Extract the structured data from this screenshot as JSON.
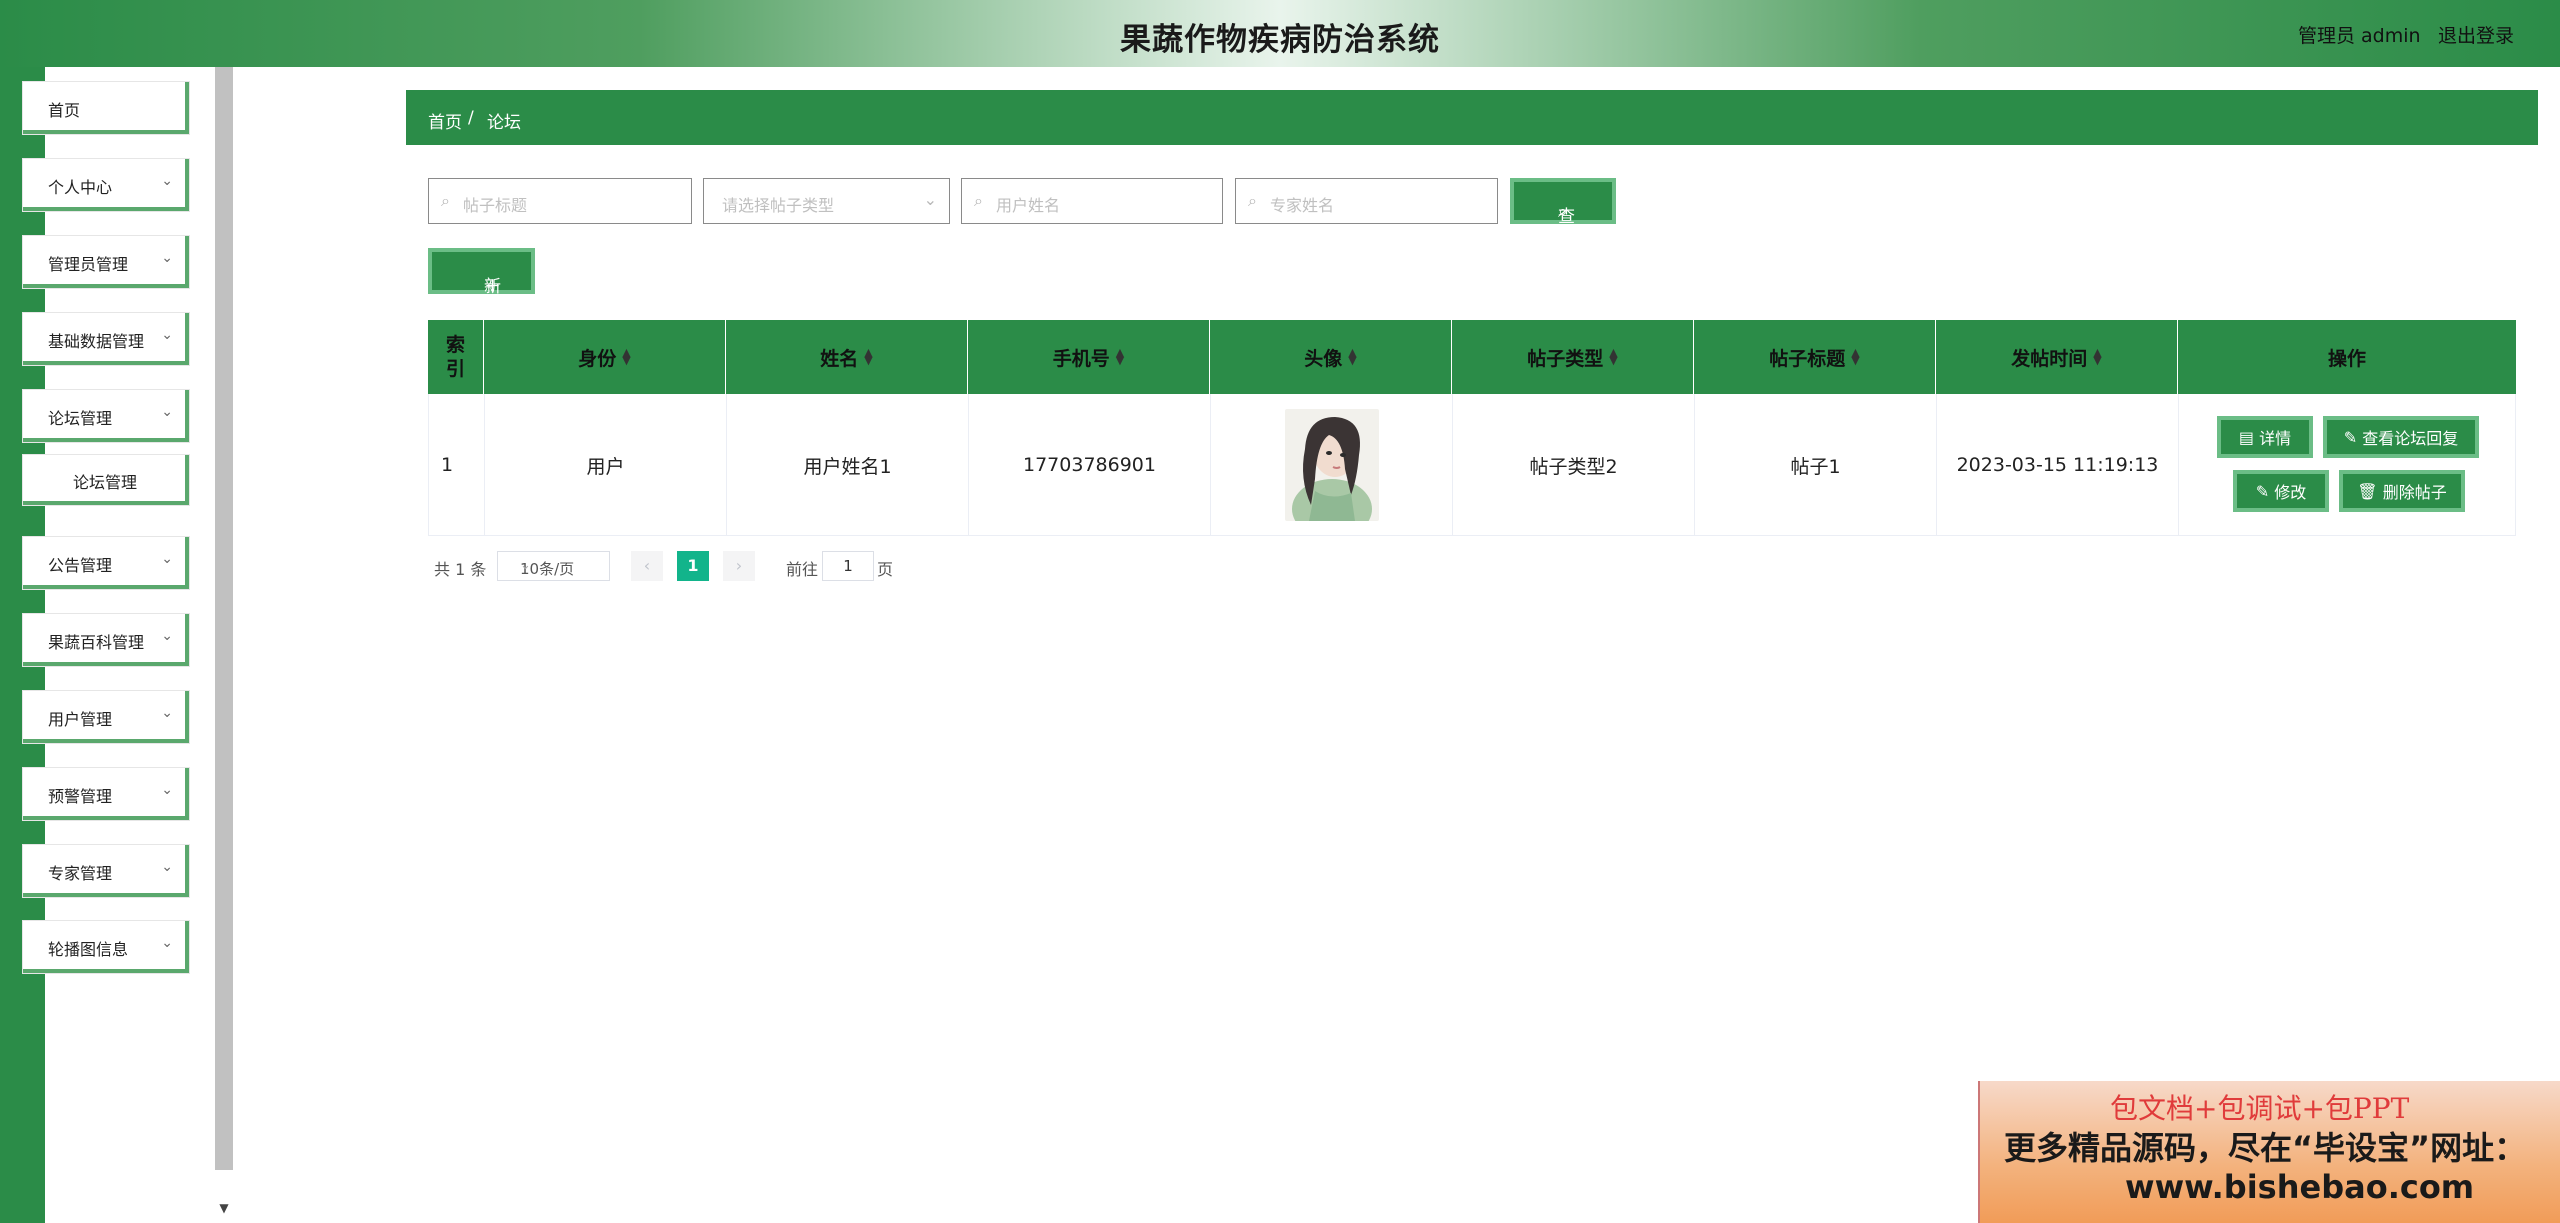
{
  "header": {
    "title": "果蔬作物疾病防治系统",
    "user": "管理员 admin",
    "logout": "退出登录"
  },
  "sidebar": {
    "items": [
      {
        "label": "首页",
        "has_arrow": false
      },
      {
        "label": "个人中心",
        "has_arrow": true
      },
      {
        "label": "管理员管理",
        "has_arrow": true
      },
      {
        "label": "基础数据管理",
        "has_arrow": true
      },
      {
        "label": "论坛管理",
        "has_arrow": true
      },
      {
        "label": "论坛管理",
        "sub": true
      },
      {
        "label": "公告管理",
        "has_arrow": true
      },
      {
        "label": "果蔬百科管理",
        "has_arrow": true
      },
      {
        "label": "用户管理",
        "has_arrow": true
      },
      {
        "label": "预警管理",
        "has_arrow": true
      },
      {
        "label": "专家管理",
        "has_arrow": true
      },
      {
        "label": "轮播图信息",
        "has_arrow": true
      }
    ]
  },
  "breadcrumb": {
    "home": "首页",
    "separator": "/",
    "current": "论坛"
  },
  "search": {
    "title_placeholder": "帖子标题",
    "type_placeholder": "请选择帖子类型",
    "user_placeholder": "用户姓名",
    "expert_placeholder": "专家姓名",
    "query_label": "查询"
  },
  "actions": {
    "add_label": "新增"
  },
  "table": {
    "headers": [
      "索引",
      "身份",
      "姓名",
      "手机号",
      "头像",
      "帖子类型",
      "帖子标题",
      "发帖时间",
      "操作"
    ],
    "rows": [
      {
        "index": "1",
        "identity": "用户",
        "name": "用户姓名1",
        "phone": "17703786901",
        "post_type": "帖子类型2",
        "post_title": "帖子1",
        "post_time": "2023-03-15 11:19:13"
      }
    ],
    "row_actions": {
      "detail": "详情",
      "view_replies": "查看论坛回复",
      "edit": "修改",
      "delete": "删除帖子"
    }
  },
  "pagination": {
    "total": "共 1 条",
    "page_size": "10条/页",
    "current_page": "1",
    "goto_label": "前往",
    "goto_value": "1",
    "page_suffix": "页"
  },
  "ad": {
    "line1": "包文档+包调试+包PPT",
    "line2": "更多精品源码，尽在“毕设宝”网址：",
    "line3": "www.bishebao.com"
  },
  "colors": {
    "primary": "#2b8c48",
    "accent_border": "#6bbd86",
    "page_active": "#12b48b"
  }
}
